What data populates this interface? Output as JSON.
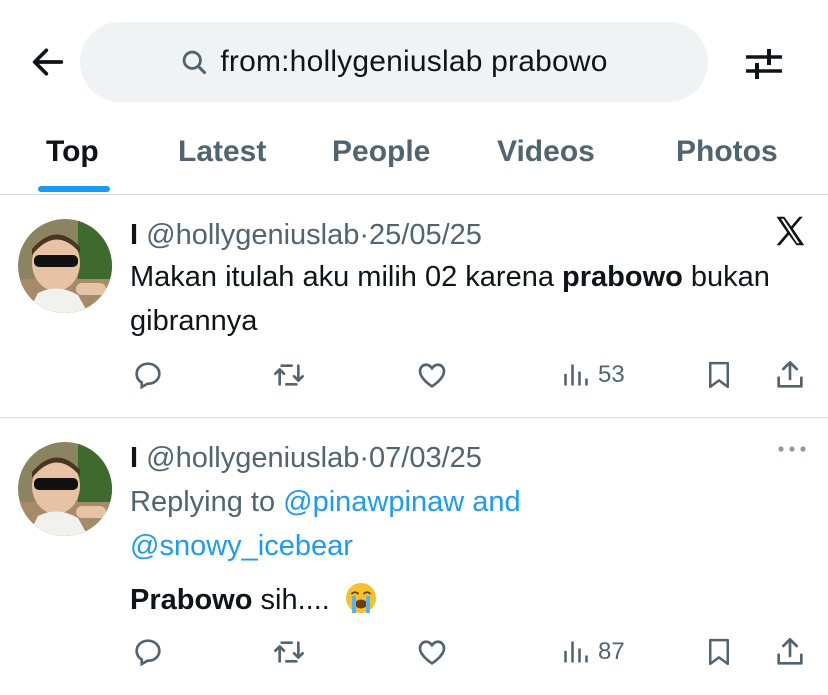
{
  "search": {
    "query": "from:hollygeniuslab prabowo"
  },
  "tabs": [
    {
      "label": "Top"
    },
    {
      "label": "Latest"
    },
    {
      "label": "People"
    },
    {
      "label": "Videos"
    },
    {
      "label": "Photos"
    }
  ],
  "tweets": [
    {
      "display_name": "I",
      "handle": "@hollygeniuslab",
      "separator": "·",
      "date": "25/05/25",
      "text_before": "Makan itulah aku milih 02 karena ",
      "text_bold": "prabowo",
      "text_after": " bukan gibrannya",
      "views": "53"
    },
    {
      "display_name": "I",
      "handle": "@hollygeniuslab",
      "separator": "·",
      "date": "07/03/25",
      "reply_prefix": "Replying to ",
      "reply_user1": "@pinawpinaw",
      "reply_and": " and",
      "reply_user2": "@snowy_icebear",
      "text_bold": "Prabowo",
      "text_after": " sih....",
      "views": "87"
    }
  ],
  "icons": {
    "back": "arrow-left-icon",
    "search": "search-icon",
    "filter": "filter-sliders-icon",
    "reply": "reply-icon",
    "retweet": "retweet-icon",
    "like": "heart-icon",
    "views": "views-icon",
    "bookmark": "bookmark-icon",
    "share": "share-icon",
    "x_logo": "x-logo-icon",
    "more": "more-icon",
    "emoji": "crying-face-icon"
  },
  "colors": {
    "accent": "#1d9bf0",
    "text": "#0f1419",
    "secondary": "#536471",
    "search_bg": "#eff3f4",
    "divider": "#cfd9de"
  }
}
